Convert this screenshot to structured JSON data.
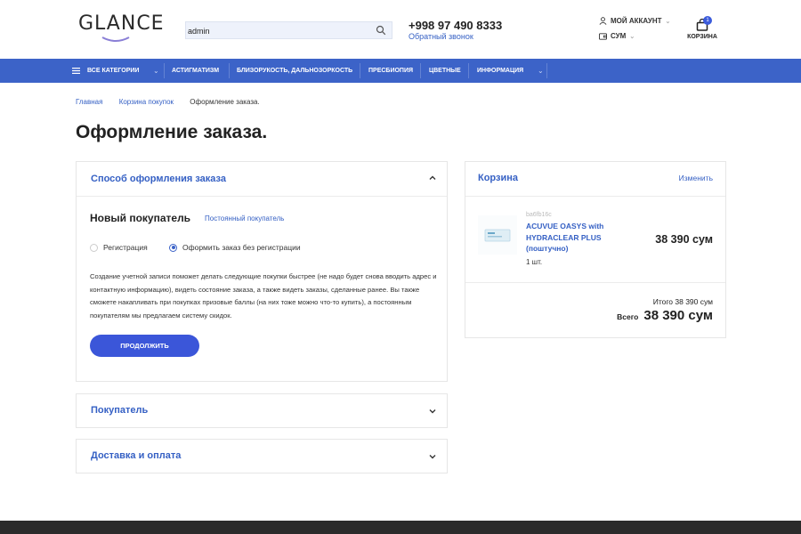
{
  "header": {
    "logo_text": "GLANCE",
    "search": {
      "value": "admin",
      "placeholder": ""
    },
    "phone": "+998 97 490 8333",
    "callback": "Обратный звонок",
    "account": "МОЙ АККАУНТ",
    "currency": "СУМ",
    "cart_label": "КОРЗИНА",
    "cart_count": "1"
  },
  "nav": {
    "items": [
      {
        "label": "ВСЕ КАТЕГОРИИ"
      },
      {
        "label": "АСТИГМАТИЗМ"
      },
      {
        "label": "БЛИЗОРУКОСТЬ, ДАЛЬНОЗОРКОСТЬ"
      },
      {
        "label": "ПРЕСБИОПИЯ"
      },
      {
        "label": "ЦВЕТНЫЕ"
      },
      {
        "label": "ИНФОРМАЦИЯ"
      }
    ]
  },
  "breadcrumb": [
    "Главная",
    "Корзина покупок",
    "Оформление заказа."
  ],
  "page_title": "Оформление заказа.",
  "checkout_method": {
    "title": "Способ оформления заказа",
    "new_buyer": "Новый покупатель",
    "regular_buyer": "Постоянный покупатель",
    "option_register": "Регистрация",
    "option_guest": "Оформить заказ без регистрации",
    "info": "Создание учетной записи поможет делать следующие покупки быстрее (не надо будет снова вводить адрес и контактную информацию), видеть состояние заказа, а также видеть заказы, сделанные ранее. Вы также сможете накапливать при покупках призовые баллы (на них тоже можно что-то купить), а постоянным покупателям мы предлагаем систему скидок.",
    "continue": "ПРОДОЛЖИТЬ"
  },
  "buyer_section": {
    "title": "Покупатель"
  },
  "delivery_section": {
    "title": "Доставка и оплата"
  },
  "cart": {
    "title": "Корзина",
    "edit": "Изменить",
    "item": {
      "sku": "ba6fb16c",
      "name": "ACUVUE OASYS with HYDRACLEAR PLUS (поштучно)",
      "qty": "1 шт.",
      "price": "38 390 сум"
    },
    "subtotal": "Итого 38 390 сум",
    "total_label": "Всего",
    "total_value": "38 390 сум"
  },
  "colors": {
    "accent": "#3c63c8",
    "link": "#3560c4",
    "button": "#3b56d9"
  }
}
